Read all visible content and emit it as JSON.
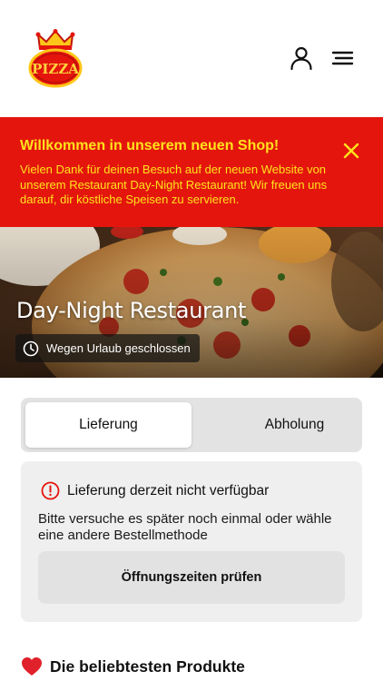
{
  "header": {
    "logo_text": "PIZZA",
    "logo_icon": "crown-pizza-logo",
    "account_icon": "user-icon",
    "menu_icon": "hamburger-menu-icon"
  },
  "banner": {
    "title": "Willkommen in unserem neuen Shop!",
    "text": "Vielen Dank für deinen Besuch auf der neuen Website von unserem Restaurant Day-Night Restaurant! Wir freuen uns darauf, dir köstliche Speisen zu servieren.",
    "close_icon": "close-icon",
    "background_color": "#e4150d",
    "text_color": "#ffe21c"
  },
  "hero": {
    "restaurant_name": "Day-Night Restaurant",
    "status": "Wegen Urlaub geschlossen",
    "status_icon": "clock-icon"
  },
  "order_method": {
    "options": [
      "Lieferung",
      "Abholung"
    ],
    "selected": "Lieferung"
  },
  "notice": {
    "icon": "info-icon",
    "title": "Lieferung derzeit nicht verfügbar",
    "text": "Bitte versuche es später noch einmal oder wähle eine andere Bestellmethode",
    "button_label": "Öffnungszeiten prüfen"
  },
  "popular": {
    "icon": "heart-icon",
    "title": "Die beliebtesten Produkte"
  }
}
